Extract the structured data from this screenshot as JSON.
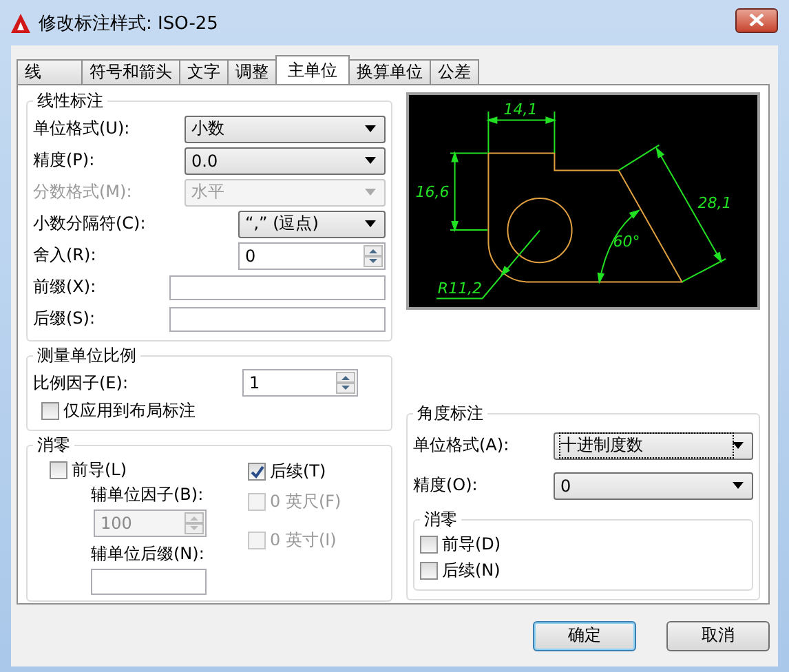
{
  "window": {
    "title": "修改标注样式: ISO-25"
  },
  "tabs": [
    {
      "label": "线",
      "selected": false
    },
    {
      "label": "符号和箭头",
      "selected": false
    },
    {
      "label": "文字",
      "selected": false
    },
    {
      "label": "调整",
      "selected": false
    },
    {
      "label": "主单位",
      "selected": true
    },
    {
      "label": "换算单位",
      "selected": false
    },
    {
      "label": "公差",
      "selected": false
    }
  ],
  "linear": {
    "title": "线性标注",
    "rows": [
      {
        "kind": "dropdown",
        "label": "单位格式(U):",
        "value": "小数",
        "disabled": false,
        "wide": true
      },
      {
        "kind": "dropdown",
        "label": "精度(P):",
        "value": "0.0",
        "disabled": false,
        "wide": true
      },
      {
        "kind": "dropdown",
        "label": "分数格式(M):",
        "value": "水平",
        "disabled": true,
        "wide": true
      },
      {
        "kind": "dropdown",
        "label": "小数分隔符(C):",
        "value": "“,” (逗点)",
        "disabled": false,
        "wide": false
      },
      {
        "kind": "spin",
        "label": "舍入(R):",
        "value": "0",
        "disabled": false,
        "wide": false
      },
      {
        "kind": "field",
        "label": "前缀(X):",
        "wide": true
      },
      {
        "kind": "field",
        "label": "后缀(S):",
        "wide": true
      }
    ]
  },
  "scale": {
    "title": "测量单位比例",
    "factor": {
      "label": "比例因子(E):",
      "value": "1"
    },
    "layout_only": {
      "label": "仅应用到布局标注",
      "checked": false
    }
  },
  "zero": {
    "title": "消零",
    "leading": {
      "label": "前导(L)",
      "checked": false,
      "disabled": false
    },
    "sub_factor": {
      "label": "辅单位因子(B):",
      "value": "100",
      "disabled": true
    },
    "sub_suffix": {
      "label": "辅单位后缀(N):"
    },
    "trailing": {
      "label": "后续(T)",
      "checked": true,
      "disabled": false
    },
    "feet": {
      "label": "0 英尺(F)",
      "checked": false,
      "disabled": true
    },
    "inches": {
      "label": "0 英寸(I)",
      "checked": false,
      "disabled": true
    }
  },
  "preview": {
    "labels": [
      "14,1",
      "16,6",
      "28,1",
      "60°",
      "R11,2"
    ]
  },
  "angular": {
    "title": "角度标注",
    "unit_format": {
      "label": "单位格式(A):",
      "value": "十进制度数",
      "focused": true
    },
    "precision": {
      "label": "精度(O):",
      "value": "0",
      "focused": false
    },
    "zero": {
      "title": "消零",
      "leading": {
        "label": "前导(D)",
        "checked": false,
        "disabled": false
      },
      "trailing": {
        "label": "后续(N)",
        "checked": false,
        "disabled": false
      }
    }
  },
  "buttons": [
    {
      "label": "确定",
      "selected": true
    },
    {
      "label": "取消",
      "selected": false
    }
  ]
}
